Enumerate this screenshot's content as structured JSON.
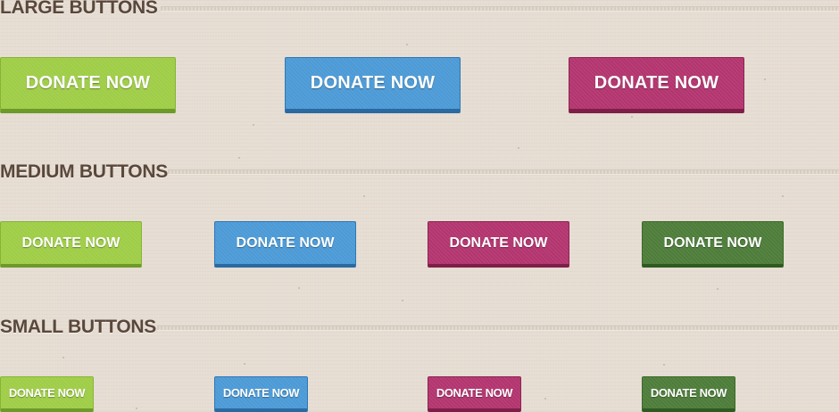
{
  "sections": {
    "large": {
      "heading": "LARGE BUTTONS"
    },
    "medium": {
      "heading": "MEDIUM BUTTONS"
    },
    "small": {
      "heading": "SMALL BUTTONS"
    }
  },
  "buttons": {
    "large": [
      {
        "label": "DONATE NOW",
        "color": "green"
      },
      {
        "label": "DONATE NOW",
        "color": "blue"
      },
      {
        "label": "DONATE NOW",
        "color": "magenta"
      }
    ],
    "medium": [
      {
        "label": "DONATE NOW",
        "color": "green"
      },
      {
        "label": "DONATE NOW",
        "color": "blue"
      },
      {
        "label": "DONATE NOW",
        "color": "magenta"
      },
      {
        "label": "DONATE NOW",
        "color": "dark-green"
      }
    ],
    "small": [
      {
        "label": "DONATE NOW",
        "color": "green"
      },
      {
        "label": "DONATE NOW",
        "color": "blue"
      },
      {
        "label": "DONATE NOW",
        "color": "magenta"
      },
      {
        "label": "DONATE NOW",
        "color": "dark-green"
      }
    ]
  },
  "colors": {
    "background": "#e6ddd3",
    "heading": "#5a483b",
    "green": "#9fcd47",
    "blue": "#4c9ad6",
    "magenta": "#b3356f",
    "dark-green": "#4e7d3a"
  }
}
